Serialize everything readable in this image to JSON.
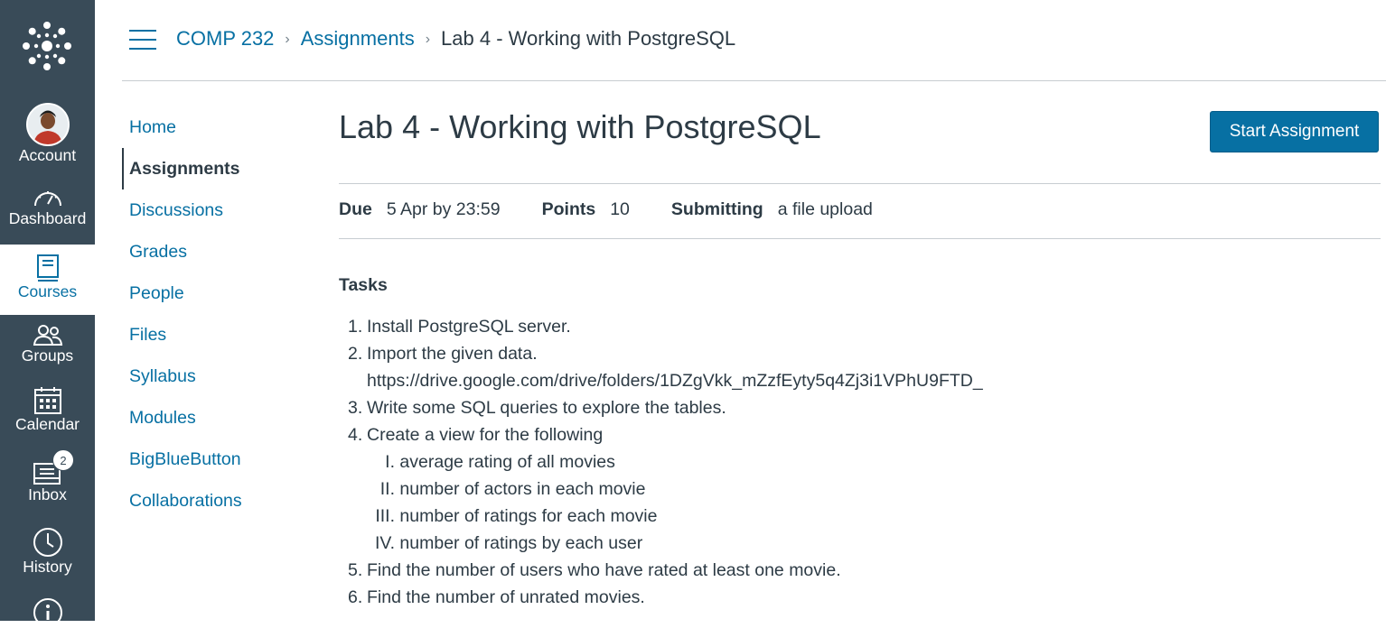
{
  "global_nav": {
    "items": [
      {
        "label": "Account",
        "icon": "avatar"
      },
      {
        "label": "Dashboard",
        "icon": "dashboard-icon"
      },
      {
        "label": "Courses",
        "icon": "courses-icon",
        "active": true
      },
      {
        "label": "Groups",
        "icon": "groups-icon"
      },
      {
        "label": "Calendar",
        "icon": "calendar-icon"
      },
      {
        "label": "Inbox",
        "icon": "inbox-icon",
        "badge": "2"
      },
      {
        "label": "History",
        "icon": "clock-icon"
      },
      {
        "label": "",
        "icon": "help-icon"
      }
    ]
  },
  "breadcrumb": {
    "course": "COMP 232",
    "section": "Assignments",
    "current": "Lab 4 - Working with PostgreSQL"
  },
  "course_nav": {
    "items": [
      "Home",
      "Assignments",
      "Discussions",
      "Grades",
      "People",
      "Files",
      "Syllabus",
      "Modules",
      "BigBlueButton",
      "Collaborations"
    ],
    "active": "Assignments"
  },
  "assignment": {
    "title": "Lab 4 - Working with PostgreSQL",
    "start_button": "Start Assignment",
    "due_label": "Due",
    "due_value": "5 Apr by 23:59",
    "points_label": "Points",
    "points_value": "10",
    "submitting_label": "Submitting",
    "submitting_value": "a file upload",
    "tasks_heading": "Tasks",
    "tasks": [
      "Install PostgreSQL server.",
      "Import the given data.",
      "Write some SQL queries to explore the tables.",
      "Create a view for the following",
      "Find the number of users who have rated at least one movie.",
      "Find the number of unrated movies."
    ],
    "task2_link": "https://drive.google.com/drive/folders/1DZgVkk_mZzfEyty5q4Zj3i1VPhU9FTD_",
    "subtasks": [
      {
        "num": "I.",
        "text": "average rating of all movies"
      },
      {
        "num": "II.",
        "text": "number of actors in each movie"
      },
      {
        "num": "III.",
        "text": "number of ratings for each movie"
      },
      {
        "num": "IV.",
        "text": "number of ratings by each user"
      }
    ]
  },
  "colors": {
    "nav_bg": "#394b58",
    "link": "#0770a3",
    "text": "#2d3b45",
    "button": "#0770a3"
  }
}
